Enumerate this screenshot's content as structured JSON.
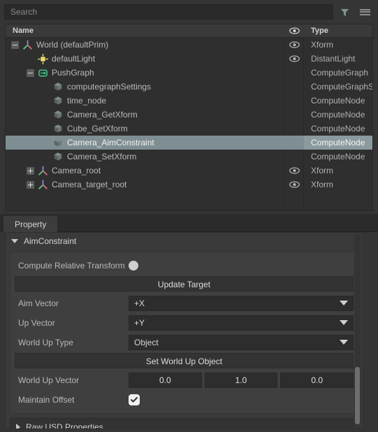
{
  "search": {
    "placeholder": "Search",
    "value": "",
    "filter_icon": "filter-funnel-icon",
    "menu_icon": "hamburger-menu-icon"
  },
  "tree": {
    "columns": {
      "name": "Name",
      "visibility_icon": "eye-icon",
      "type": "Type"
    },
    "rows": [
      {
        "label": "World (defaultPrim)",
        "type": "Xform",
        "depth": 0,
        "icon": "xform-axis-icon",
        "expander": "minus",
        "eye": true,
        "selected": false
      },
      {
        "label": "defaultLight",
        "type": "DistantLight",
        "depth": 1,
        "icon": "light-icon",
        "expander": "none",
        "eye": true,
        "selected": false
      },
      {
        "label": "PushGraph",
        "type": "ComputeGraph",
        "depth": 1,
        "icon": "compute-graph-icon",
        "expander": "minus",
        "eye": false,
        "selected": false
      },
      {
        "label": "computegraphSettings",
        "type": "ComputeGraphSe",
        "depth": 2,
        "icon": "compute-node-icon",
        "expander": "none",
        "eye": false,
        "selected": false
      },
      {
        "label": "time_node",
        "type": "ComputeNode",
        "depth": 2,
        "icon": "compute-node-icon",
        "expander": "none",
        "eye": false,
        "selected": false
      },
      {
        "label": "Camera_GetXform",
        "type": "ComputeNode",
        "depth": 2,
        "icon": "compute-node-icon",
        "expander": "none",
        "eye": false,
        "selected": false
      },
      {
        "label": "Cube_GetXform",
        "type": "ComputeNode",
        "depth": 2,
        "icon": "compute-node-icon",
        "expander": "none",
        "eye": false,
        "selected": false
      },
      {
        "label": "Camera_AimConstraint",
        "type": "ComputeNode",
        "depth": 2,
        "icon": "compute-node-icon",
        "expander": "none",
        "eye": false,
        "selected": true
      },
      {
        "label": "Camera_SetXform",
        "type": "ComputeNode",
        "depth": 2,
        "icon": "compute-node-icon",
        "expander": "none",
        "eye": false,
        "selected": false
      },
      {
        "label": "Camera_root",
        "type": "Xform",
        "depth": 1,
        "icon": "xform-axis-icon",
        "expander": "plus",
        "eye": true,
        "selected": false
      },
      {
        "label": "Camera_target_root",
        "type": "Xform",
        "depth": 1,
        "icon": "xform-axis-icon",
        "expander": "plus",
        "eye": true,
        "selected": false
      }
    ]
  },
  "tabs": [
    {
      "label": "Property",
      "active": true
    }
  ],
  "property": {
    "section_title": "AimConstraint",
    "compute_relative_transform": {
      "label": "Compute Relative Transform",
      "checked": false
    },
    "update_target_label": "Update Target",
    "aim_vector": {
      "label": "Aim Vector",
      "value": "+X"
    },
    "up_vector": {
      "label": "Up Vector",
      "value": "+Y"
    },
    "world_up_type": {
      "label": "World Up Type",
      "value": "Object"
    },
    "set_world_up_object_label": "Set World Up Object",
    "world_up_vector": {
      "label": "World Up Vector",
      "x": "0.0",
      "y": "1.0",
      "z": "0.0"
    },
    "maintain_offset": {
      "label": "Maintain Offset",
      "checked": true
    },
    "raw_usd_properties": "Raw USD Properties"
  },
  "colors": {
    "selection": "#7e8e92",
    "panel_bg": "#3a3a3a",
    "window_bg": "#353535",
    "accent_graph": "#3fb883"
  }
}
